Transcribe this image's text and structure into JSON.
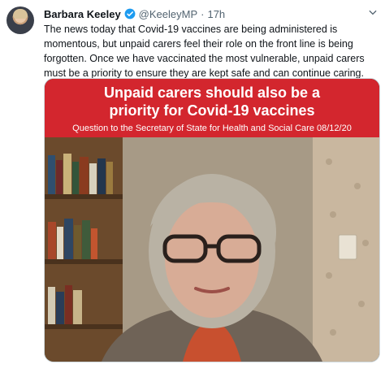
{
  "tweet": {
    "author_name": "Barbara Keeley",
    "handle": "@KeeleyMP",
    "separator": "·",
    "time": "17h",
    "text": "The news today that Covid-19 vaccines are being administered is momentous, but unpaid carers feel their role on the front line is being forgotten. Once we have vaccinated the most vulnerable, unpaid carers must be a priority to ensure they are kept safe and can continue caring."
  },
  "media": {
    "banner_line1": "Unpaid carers should also be  a",
    "banner_line2": "priority for Covid-19 vaccines",
    "banner_subtitle": "Question to the Secretary of State for Health and Social Care 08/12/20"
  },
  "colors": {
    "banner_red": "#d3262e",
    "verified_blue": "#1d9bf0",
    "text_secondary": "#536471"
  },
  "icons": {
    "verified": "verified-badge-icon",
    "more": "chevron-down-icon"
  }
}
